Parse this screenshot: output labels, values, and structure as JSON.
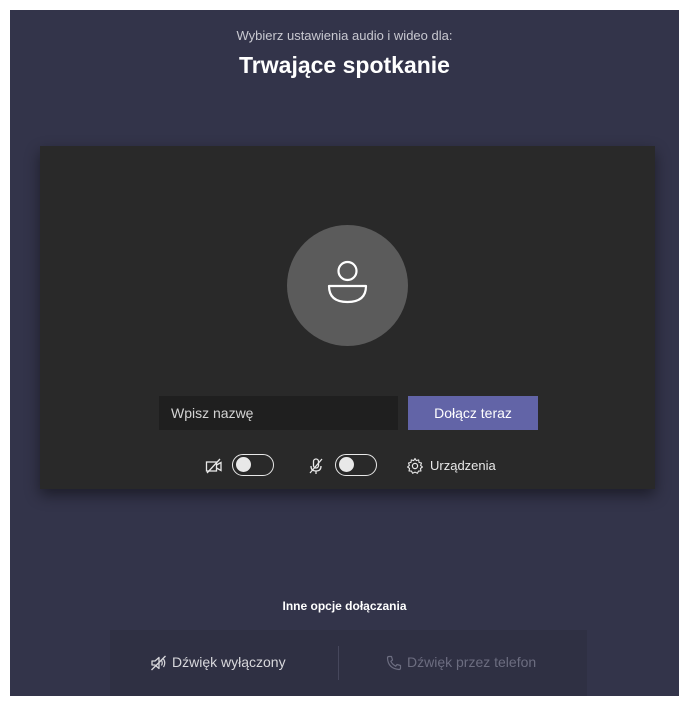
{
  "header": {
    "subtitle": "Wybierz ustawienia audio i wideo dla:",
    "title": "Trwające spotkanie"
  },
  "preview": {
    "name_placeholder": "Wpisz nazwę",
    "join_label": "Dołącz teraz",
    "camera_toggle": {
      "icon": "camera-off-icon",
      "on": false
    },
    "mic_toggle": {
      "icon": "mic-off-icon",
      "on": false
    },
    "devices_label": "Urządzenia"
  },
  "other_options": {
    "heading": "Inne opcje dołączania",
    "audio_off_label": "Dźwięk wyłączony",
    "phone_label": "Dźwięk przez telefon"
  },
  "colors": {
    "background": "#33344a",
    "preview_bg": "#292929",
    "accent": "#6264a7",
    "input_bg": "#1f1f1f"
  }
}
